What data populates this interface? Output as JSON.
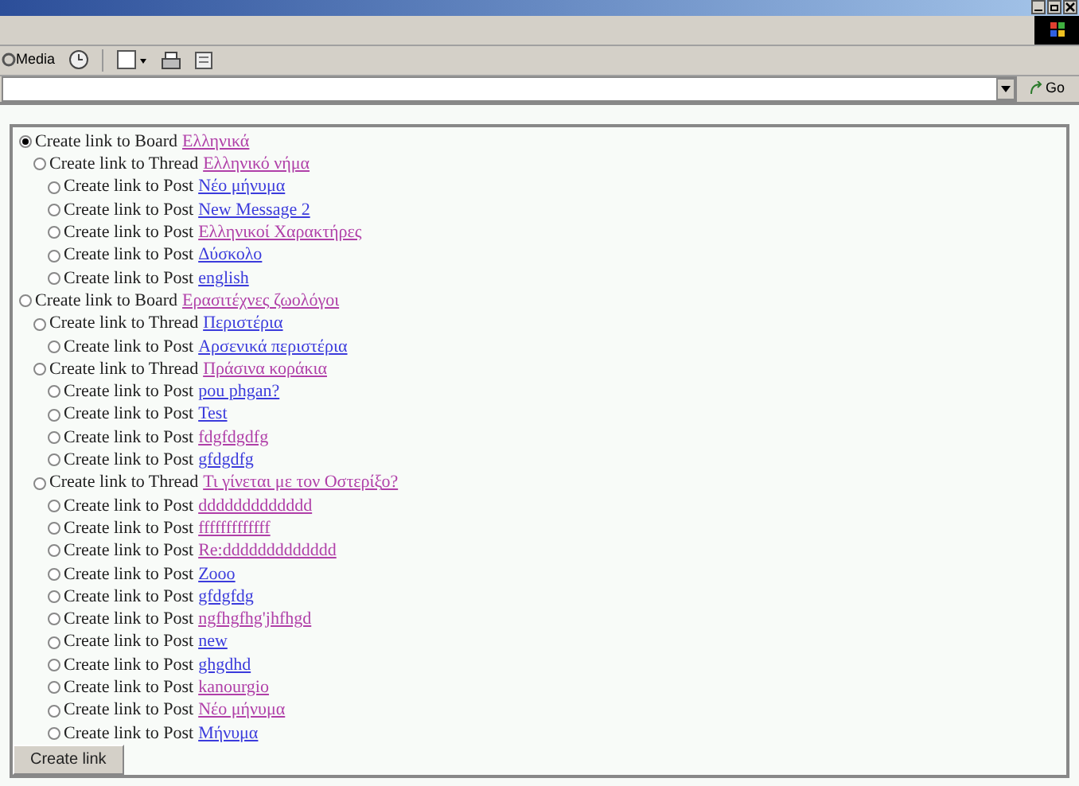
{
  "toolbar": {
    "media_label": "Media"
  },
  "address_bar": {
    "go_label": "Go"
  },
  "tree": [
    {
      "kind": "board",
      "prefix": "Create link to Board",
      "title": "Ελληνικά",
      "visited": true,
      "selected": true,
      "children": [
        {
          "kind": "thread",
          "prefix": "Create link to Thread",
          "title": "Ελληνικό νήμα",
          "visited": true,
          "selected": false,
          "children": [
            {
              "kind": "post",
              "prefix": "Create link to Post",
              "title": "Νέο μήνυμα",
              "visited": false,
              "selected": false
            },
            {
              "kind": "post",
              "prefix": "Create link to Post",
              "title": "New Message 2",
              "visited": false,
              "selected": false
            },
            {
              "kind": "post",
              "prefix": "Create link to Post",
              "title": "Ελληνικοί Χαρακτήρες",
              "visited": true,
              "selected": false
            },
            {
              "kind": "post",
              "prefix": "Create link to Post",
              "title": "Δύσκολο",
              "visited": false,
              "selected": false
            },
            {
              "kind": "post",
              "prefix": "Create link to Post",
              "title": "english",
              "visited": false,
              "selected": false
            }
          ]
        }
      ]
    },
    {
      "kind": "board",
      "prefix": "Create link to Board",
      "title": "Ερασιτέχνες ζωολόγοι",
      "visited": true,
      "selected": false,
      "children": [
        {
          "kind": "thread",
          "prefix": "Create link to Thread",
          "title": "Περιστέρια",
          "visited": false,
          "selected": false,
          "children": [
            {
              "kind": "post",
              "prefix": "Create link to Post",
              "title": "Αρσενικά περιστέρια",
              "visited": false,
              "selected": false
            }
          ]
        },
        {
          "kind": "thread",
          "prefix": "Create link to Thread",
          "title": "Πράσινα κοράκια",
          "visited": true,
          "selected": false,
          "children": [
            {
              "kind": "post",
              "prefix": "Create link to Post",
              "title": "pou phgan?",
              "visited": false,
              "selected": false
            },
            {
              "kind": "post",
              "prefix": "Create link to Post",
              "title": "Test",
              "visited": false,
              "selected": false
            },
            {
              "kind": "post",
              "prefix": "Create link to Post",
              "title": "fdgfdgdfg",
              "visited": true,
              "selected": false
            },
            {
              "kind": "post",
              "prefix": "Create link to Post",
              "title": "gfdgdfg",
              "visited": false,
              "selected": false
            }
          ]
        },
        {
          "kind": "thread",
          "prefix": "Create link to Thread",
          "title": "Τι γίνεται με τον Οστερίξο?",
          "visited": true,
          "selected": false,
          "children": [
            {
              "kind": "post",
              "prefix": "Create link to Post",
              "title": "ddddddddddddd",
              "visited": true,
              "selected": false
            },
            {
              "kind": "post",
              "prefix": "Create link to Post",
              "title": "fffffffffffff",
              "visited": true,
              "selected": false
            },
            {
              "kind": "post",
              "prefix": "Create link to Post",
              "title": "Re:ddddddddddddd",
              "visited": true,
              "selected": false
            },
            {
              "kind": "post",
              "prefix": "Create link to Post",
              "title": "Zooo",
              "visited": false,
              "selected": false
            },
            {
              "kind": "post",
              "prefix": "Create link to Post",
              "title": "gfdgfdg",
              "visited": false,
              "selected": false
            },
            {
              "kind": "post",
              "prefix": "Create link to Post",
              "title": "ngfhgfhg'jhfhgd",
              "visited": true,
              "selected": false
            },
            {
              "kind": "post",
              "prefix": "Create link to Post",
              "title": "new",
              "visited": false,
              "selected": false
            },
            {
              "kind": "post",
              "prefix": "Create link to Post",
              "title": "ghgdhd",
              "visited": false,
              "selected": false
            },
            {
              "kind": "post",
              "prefix": "Create link to Post",
              "title": "kanourgio",
              "visited": true,
              "selected": false
            },
            {
              "kind": "post",
              "prefix": "Create link to Post",
              "title": "Νέο μήνυμα",
              "visited": true,
              "selected": false
            },
            {
              "kind": "post",
              "prefix": "Create link to Post",
              "title": "Μήνυμα",
              "visited": false,
              "selected": false
            }
          ]
        }
      ]
    }
  ],
  "submit_button": {
    "label": "Create link"
  }
}
